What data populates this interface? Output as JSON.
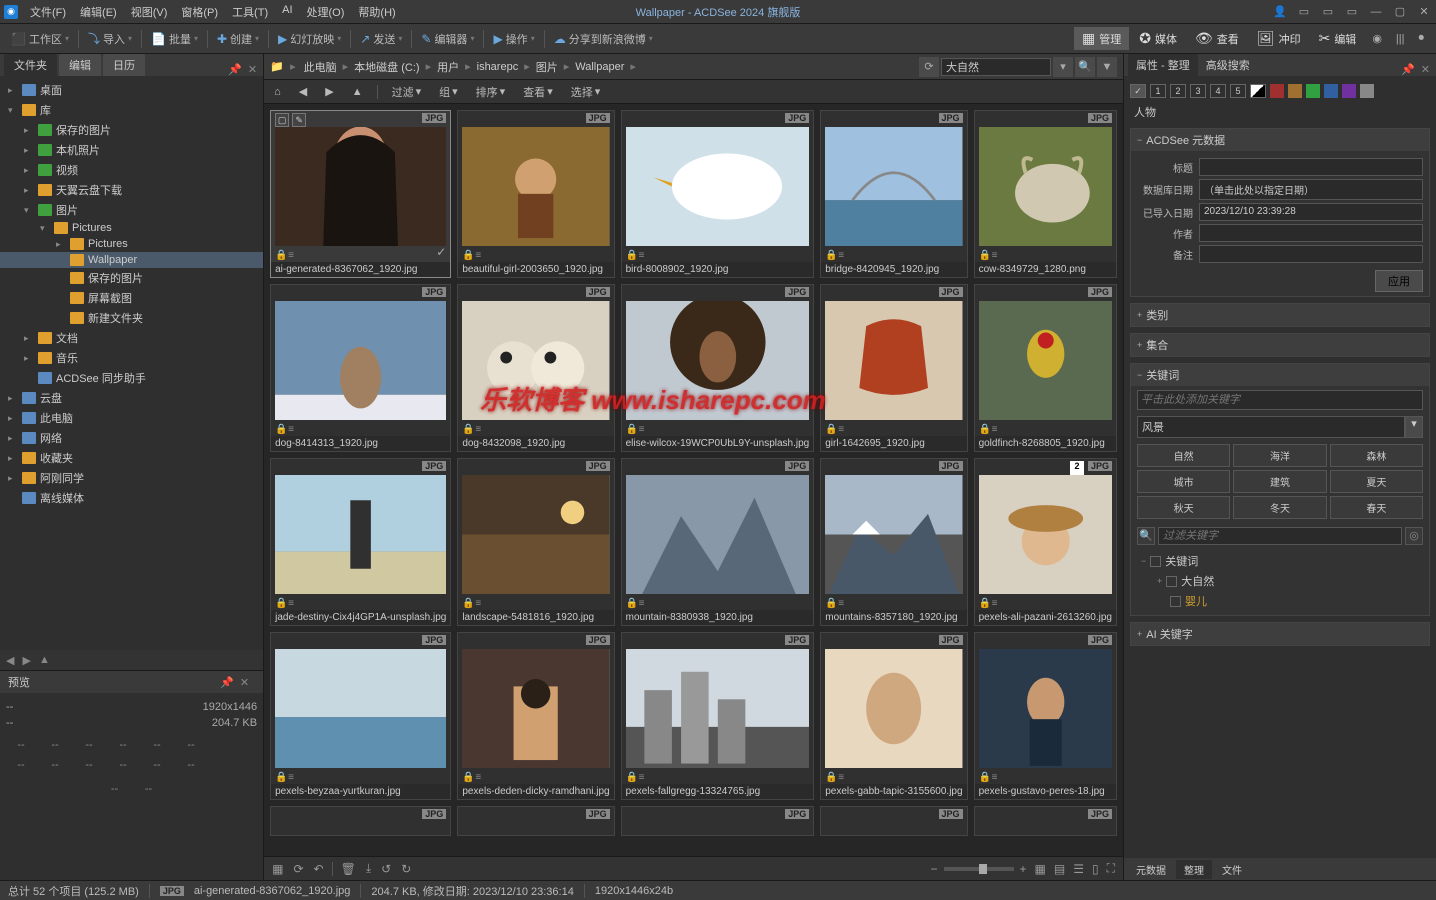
{
  "app": {
    "title": "Wallpaper - ACDSee 2024 旗舰版"
  },
  "menu": [
    "文件(F)",
    "编辑(E)",
    "视图(V)",
    "窗格(P)",
    "工具(T)",
    "AI",
    "处理(O)",
    "帮助(H)"
  ],
  "toolbar": [
    {
      "icon": "⬛",
      "label": "工作区"
    },
    {
      "icon": "⤵",
      "label": "导入"
    },
    {
      "icon": "📄",
      "label": "批量"
    },
    {
      "icon": "✚",
      "label": "创建"
    },
    {
      "icon": "▶",
      "label": "幻灯放映"
    },
    {
      "icon": "↗",
      "label": "发送"
    },
    {
      "icon": "✎",
      "label": "编辑器"
    },
    {
      "icon": "▶",
      "label": "操作"
    },
    {
      "icon": "☁",
      "label": "分享到新浪微博"
    }
  ],
  "modes": [
    {
      "icon": "▦",
      "label": "管理",
      "active": true
    },
    {
      "icon": "✪",
      "label": "媒体"
    },
    {
      "icon": "👁",
      "label": "查看"
    },
    {
      "icon": "🖼",
      "label": "冲印"
    },
    {
      "icon": "✂",
      "label": "编辑"
    }
  ],
  "extra_icons": [
    "◉",
    "|||",
    "⏺"
  ],
  "left_tabs": [
    "文件夹",
    "编辑",
    "日历"
  ],
  "folder_tree": [
    {
      "pad": 0,
      "arrow": "▸",
      "icon": "drive",
      "label": "桌面"
    },
    {
      "pad": 0,
      "arrow": "▾",
      "icon": "folder",
      "label": "库"
    },
    {
      "pad": 1,
      "arrow": "▸",
      "icon": "pic",
      "label": "保存的图片"
    },
    {
      "pad": 1,
      "arrow": "▸",
      "icon": "pic",
      "label": "本机照片"
    },
    {
      "pad": 1,
      "arrow": "▸",
      "icon": "pic",
      "label": "视频"
    },
    {
      "pad": 1,
      "arrow": "▸",
      "icon": "folder",
      "label": "天翼云盘下载"
    },
    {
      "pad": 1,
      "arrow": "▾",
      "icon": "pic",
      "label": "图片"
    },
    {
      "pad": 2,
      "arrow": "▾",
      "icon": "folder",
      "label": "Pictures"
    },
    {
      "pad": 3,
      "arrow": "▸",
      "icon": "folder",
      "label": "Pictures"
    },
    {
      "pad": 3,
      "arrow": "",
      "icon": "folder",
      "label": "Wallpaper",
      "sel": true
    },
    {
      "pad": 3,
      "arrow": "",
      "icon": "folder",
      "label": "保存的图片"
    },
    {
      "pad": 3,
      "arrow": "",
      "icon": "folder",
      "label": "屏幕截图"
    },
    {
      "pad": 3,
      "arrow": "",
      "icon": "folder",
      "label": "新建文件夹"
    },
    {
      "pad": 1,
      "arrow": "▸",
      "icon": "folder",
      "label": "文档"
    },
    {
      "pad": 1,
      "arrow": "▸",
      "icon": "folder",
      "label": "音乐"
    },
    {
      "pad": 1,
      "arrow": "",
      "icon": "app",
      "label": "ACDSee 同步助手"
    },
    {
      "pad": 0,
      "arrow": "▸",
      "icon": "cloud",
      "label": "云盘"
    },
    {
      "pad": 0,
      "arrow": "▸",
      "icon": "drive",
      "label": "此电脑"
    },
    {
      "pad": 0,
      "arrow": "▸",
      "icon": "net",
      "label": "网络"
    },
    {
      "pad": 0,
      "arrow": "▸",
      "icon": "folder",
      "label": "收藏夹"
    },
    {
      "pad": 0,
      "arrow": "▸",
      "icon": "folder",
      "label": "阿刚同学"
    },
    {
      "pad": 0,
      "arrow": "",
      "icon": "disc",
      "label": "离线媒体"
    }
  ],
  "preview": {
    "title": "预览",
    "dim": "1920x1446",
    "size": "204.7 KB"
  },
  "breadcrumb": [
    "此电脑",
    "本地磁盘 (C:)",
    "用户",
    "isharepc",
    "图片",
    "Wallpaper"
  ],
  "search_value": "大自然",
  "filter_bar": {
    "filter": "过滤",
    "group": "组",
    "sort": "排序",
    "view": "查看",
    "select": "选择"
  },
  "thumbs": [
    {
      "name": "ai-generated-8367062_1920.jpg",
      "fmt": "JPG",
      "sel": true,
      "img": "portrait1"
    },
    {
      "name": "beautiful-girl-2003650_1920.jpg",
      "fmt": "JPG",
      "img": "girl-leaves"
    },
    {
      "name": "bird-8008902_1920.jpg",
      "fmt": "JPG",
      "img": "seagull"
    },
    {
      "name": "bridge-8420945_1920.jpg",
      "fmt": "JPG",
      "img": "bridge"
    },
    {
      "name": "cow-8349729_1280.png",
      "fmt": "JPG",
      "img": "cow"
    },
    {
      "name": "dog-8414313_1920.jpg",
      "fmt": "JPG",
      "img": "dog1"
    },
    {
      "name": "dog-8432098_1920.jpg",
      "fmt": "JPG",
      "img": "dog2"
    },
    {
      "name": "elise-wilcox-19WCP0UbL9Y-unsplash.jpg",
      "fmt": "JPG",
      "img": "curly"
    },
    {
      "name": "girl-1642695_1920.jpg",
      "fmt": "JPG",
      "img": "redhead"
    },
    {
      "name": "goldfinch-8268805_1920.jpg",
      "fmt": "JPG",
      "img": "goldfinch"
    },
    {
      "name": "jade-destiny-Cix4j4GP1A-unsplash.jpg",
      "fmt": "JPG",
      "img": "beach"
    },
    {
      "name": "landscape-5481816_1920.jpg",
      "fmt": "JPG",
      "img": "landscape"
    },
    {
      "name": "mountain-8380938_1920.jpg",
      "fmt": "JPG",
      "img": "mountain1"
    },
    {
      "name": "mountains-8357180_1920.jpg",
      "fmt": "JPG",
      "img": "mountain2"
    },
    {
      "name": "pexels-ali-pazani-2613260.jpg",
      "fmt": "JPG",
      "img": "hat",
      "num": "2"
    },
    {
      "name": "pexels-beyzaa-yurtkuran.jpg",
      "fmt": "JPG",
      "img": "sea"
    },
    {
      "name": "pexels-deden-dicky-ramdhani.jpg",
      "fmt": "JPG",
      "img": "cafe"
    },
    {
      "name": "pexels-fallgregg-13324765.jpg",
      "fmt": "JPG",
      "img": "city"
    },
    {
      "name": "pexels-gabb-tapic-3155600.jpg",
      "fmt": "JPG",
      "img": "face"
    },
    {
      "name": "pexels-gustavo-peres-18.jpg",
      "fmt": "JPG",
      "img": "woman"
    }
  ],
  "right": {
    "tabs": [
      "属性 - 整理",
      "高级搜索"
    ],
    "person": "人物",
    "metadata": {
      "title": "ACDSee 元数据",
      "fields": {
        "标题": "",
        "数据库日期": "（单击此处以指定日期）",
        "已导入日期": "2023/12/10 23:39:28",
        "作者": "",
        "备注": ""
      },
      "apply": "应用"
    },
    "sections": [
      "类别",
      "集合"
    ],
    "keywords": {
      "title": "关键词",
      "placeholder": "平击此处添加关键字",
      "preset": "风景",
      "grid": [
        "自然",
        "海洋",
        "森林",
        "城市",
        "建筑",
        "夏天",
        "秋天",
        "冬天",
        "春天"
      ],
      "filter_placeholder": "过滤关键字",
      "tree_root": "关键词",
      "tree_items": [
        "大自然",
        "婴儿"
      ]
    },
    "ai_section": "AI 关键字",
    "bottom_tabs": [
      "元数据",
      "整理",
      "文件"
    ]
  },
  "status": {
    "total": "总计 52 个项目 (125.2 MB)",
    "fmt": "JPG",
    "file": "ai-generated-8367062_1920.jpg",
    "info": "204.7 KB, 修改日期: 2023/12/10 23:36:14",
    "dim": "1920x1446x24b"
  },
  "watermark": "乐软博客 www.isharepc.com"
}
